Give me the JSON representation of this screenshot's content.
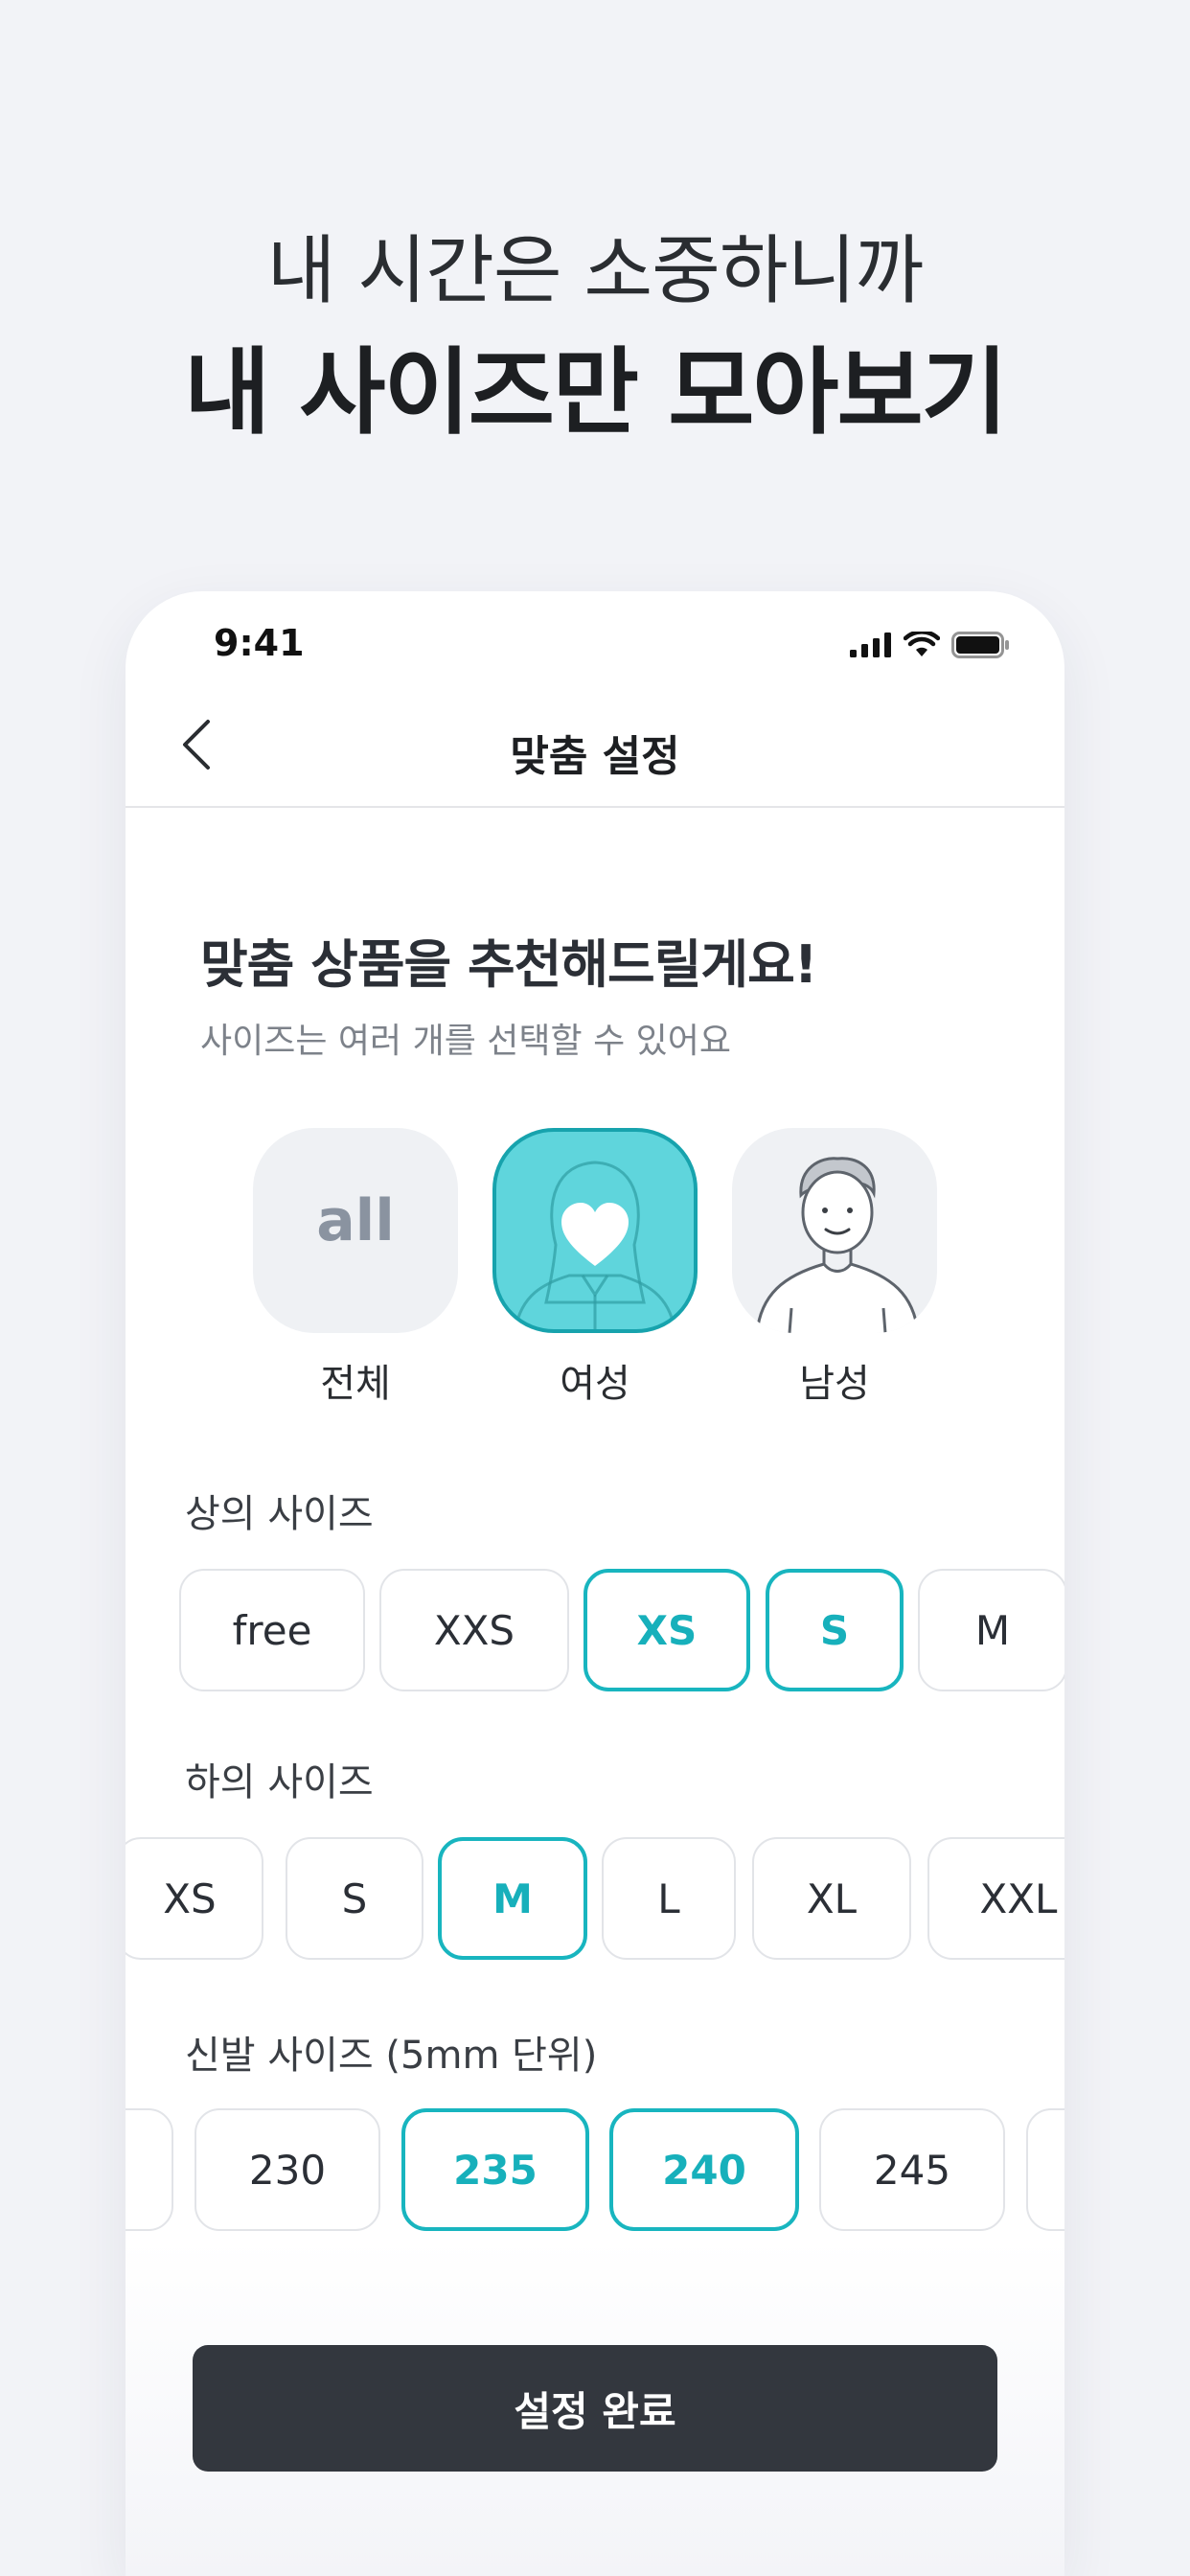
{
  "promo": {
    "line1": "내 시간은 소중하니까",
    "line2": "내 사이즈만 모아보기"
  },
  "status_bar": {
    "time": "9:41"
  },
  "nav": {
    "title": "맞춤 설정"
  },
  "intro": {
    "title": "맞춤 상품을 추천해드릴게요!",
    "subtitle": "사이즈는 여러 개를 선택할 수 있어요"
  },
  "gender_options": [
    {
      "icon_text": "all",
      "label": "전체",
      "selected": false
    },
    {
      "label": "여성",
      "selected": true
    },
    {
      "label": "남성",
      "selected": false
    }
  ],
  "top_sizes": {
    "label": "상의 사이즈",
    "options": [
      {
        "label": "free",
        "selected": false
      },
      {
        "label": "XXS",
        "selected": false
      },
      {
        "label": "XS",
        "selected": true
      },
      {
        "label": "S",
        "selected": true
      },
      {
        "label": "M",
        "selected": false
      }
    ]
  },
  "bottom_sizes": {
    "label": "하의 사이즈",
    "options": [
      {
        "label": "XS",
        "selected": false
      },
      {
        "label": "S",
        "selected": false
      },
      {
        "label": "M",
        "selected": true
      },
      {
        "label": "L",
        "selected": false
      },
      {
        "label": "XL",
        "selected": false
      },
      {
        "label": "XXL",
        "selected": false
      }
    ]
  },
  "shoe_sizes": {
    "label": "신발 사이즈 (5mm 단위)",
    "options": [
      {
        "label": "230",
        "selected": false
      },
      {
        "label": "235",
        "selected": true
      },
      {
        "label": "240",
        "selected": true
      },
      {
        "label": "245",
        "selected": false
      }
    ]
  },
  "done_button": {
    "label": "설정 완료"
  },
  "colors": {
    "accent": "#18b5bf",
    "selected_tile": "#5fd5dc",
    "button_dark": "#33373e"
  }
}
